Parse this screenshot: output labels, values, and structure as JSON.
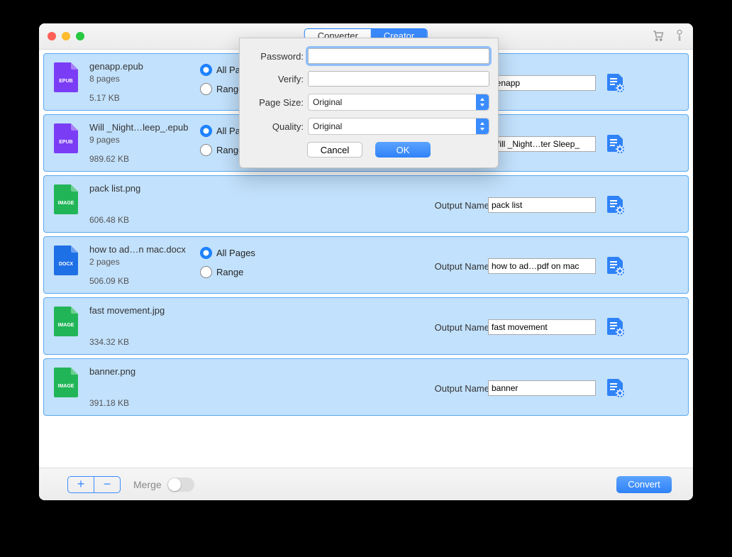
{
  "titlebar": {
    "seg_left": "Converter",
    "seg_right": "Creator"
  },
  "labels": {
    "all_pages": "All Pages",
    "range": "Range",
    "output_name": "Output Name",
    "merge": "Merge",
    "convert": "Convert"
  },
  "files": [
    {
      "name": "genapp.epub",
      "pages": "8 pages",
      "size": "5.17 KB",
      "type": "EPUB",
      "color": "#7a3df5",
      "output": "genapp",
      "has_pages": true
    },
    {
      "name": "Will _Night…leep_.epub",
      "pages": "9 pages",
      "size": "989.62 KB",
      "type": "EPUB",
      "color": "#7a3df5",
      "output": "Will _Night…ter Sleep_",
      "has_pages": true
    },
    {
      "name": "pack list.png",
      "pages": "",
      "size": "606.48 KB",
      "type": "IMAGE",
      "color": "#22b558",
      "output": "pack list",
      "has_pages": false
    },
    {
      "name": "how to ad…n mac.docx",
      "pages": "2 pages",
      "size": "506.09 KB",
      "type": "DOCX",
      "color": "#1e70e6",
      "output": "how to ad…pdf on mac",
      "has_pages": true
    },
    {
      "name": "fast movement.jpg",
      "pages": "",
      "size": "334.32 KB",
      "type": "IMAGE",
      "color": "#22b558",
      "output": "fast movement",
      "has_pages": false
    },
    {
      "name": "banner.png",
      "pages": "",
      "size": "391.18 KB",
      "type": "IMAGE",
      "color": "#22b558",
      "output": "banner",
      "has_pages": false
    }
  ],
  "modal": {
    "password_label": "Password:",
    "verify_label": "Verify:",
    "page_size_label": "Page Size:",
    "quality_label": "Quality:",
    "page_size_value": "Original",
    "quality_value": "Original",
    "cancel": "Cancel",
    "ok": "OK"
  }
}
